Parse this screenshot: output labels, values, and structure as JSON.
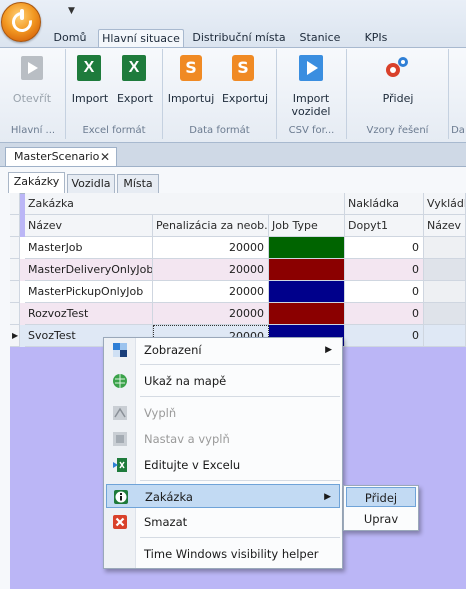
{
  "ribbon_tabs": [
    "Domů",
    "Hlavní situace",
    "Distribuční místa",
    "Stanice",
    "KPIs"
  ],
  "ribbon": {
    "otevrit": "Otevřít",
    "import": "Import",
    "export": "Export",
    "importuj": "Importuj",
    "exportuj": "Exportuj",
    "import_vozidel_1": "Import",
    "import_vozidel_2": "vozidel",
    "pridej": "Přidej",
    "groups": [
      "Hlavní ...",
      "Excel formát",
      "Data formát",
      "CSV for...",
      "Vzory řešení",
      "Da"
    ]
  },
  "icons": {
    "excel_letter": "X",
    "csv_letter": "S"
  },
  "document_tab": "MasterScenario",
  "inner_tabs": [
    "Zakázky",
    "Vozidla",
    "Místa"
  ],
  "grid": {
    "group_headers": [
      "Zakázka",
      "Nakládka",
      "Vykládka"
    ],
    "columns": [
      "Název",
      "Penalizácia za neob...",
      "Job Type",
      "Dopyt1",
      "Název"
    ],
    "rows": [
      {
        "name": "MasterJob",
        "penalty": "20000",
        "job_color": "#006400",
        "dopyt": "0"
      },
      {
        "name": "MasterDeliveryOnlyJob",
        "penalty": "20000",
        "job_color": "#8b0000",
        "dopyt": "0"
      },
      {
        "name": "MasterPickupOnlyJob",
        "penalty": "20000",
        "job_color": "#00008b",
        "dopyt": "0"
      },
      {
        "name": "RozvozTest",
        "penalty": "20000",
        "job_color": "#8b0000",
        "dopyt": "0"
      },
      {
        "name": "SvozTest",
        "penalty": "20000",
        "job_color": "#00008b",
        "dopyt": "0"
      }
    ]
  },
  "context_menu": {
    "zobrazeni": "Zobrazení",
    "ukaz": "Ukaž na mapě",
    "vypln": "Vyplň",
    "nastav": "Nastav a vyplň",
    "edituj": "Editujte v Excelu",
    "zakazka": "Zakázka",
    "smazat": "Smazat",
    "time_windows": "Time Windows visibility helper"
  },
  "submenu": {
    "pridej": "Přidej",
    "uprav": "Uprav"
  }
}
